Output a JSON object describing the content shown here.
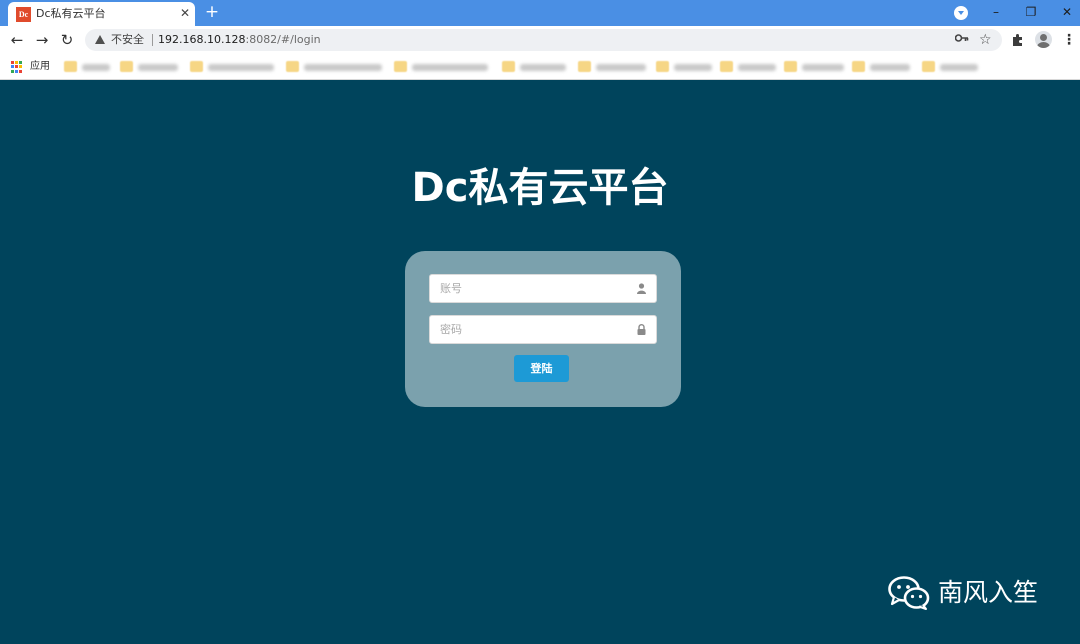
{
  "browser": {
    "tab": {
      "favicon_text": "Dc",
      "title": "Dc私有云平台",
      "close": "✕"
    },
    "new_tab": "+",
    "window_controls": {
      "minimize": "–",
      "restore": "❐",
      "close": "✕"
    },
    "nav": {
      "back": "←",
      "forward": "→",
      "reload": "↻"
    },
    "address_bar": {
      "security_label": "不安全",
      "url_host": "192.168.10.128",
      "url_rest": ":8082/#/login"
    },
    "bookmarks_bar": {
      "apps_label": "应用"
    },
    "colors": {
      "titlebar": "#4a8fe4",
      "page_bg": "#00445c"
    }
  },
  "page": {
    "title": "Dc私有云平台",
    "login": {
      "username_placeholder": "账号",
      "password_placeholder": "密码",
      "submit_label": "登陆"
    },
    "colors": {
      "card": "#7ba1ad",
      "button": "#1d9ad6"
    }
  },
  "watermark": {
    "text": "南风入笙"
  }
}
